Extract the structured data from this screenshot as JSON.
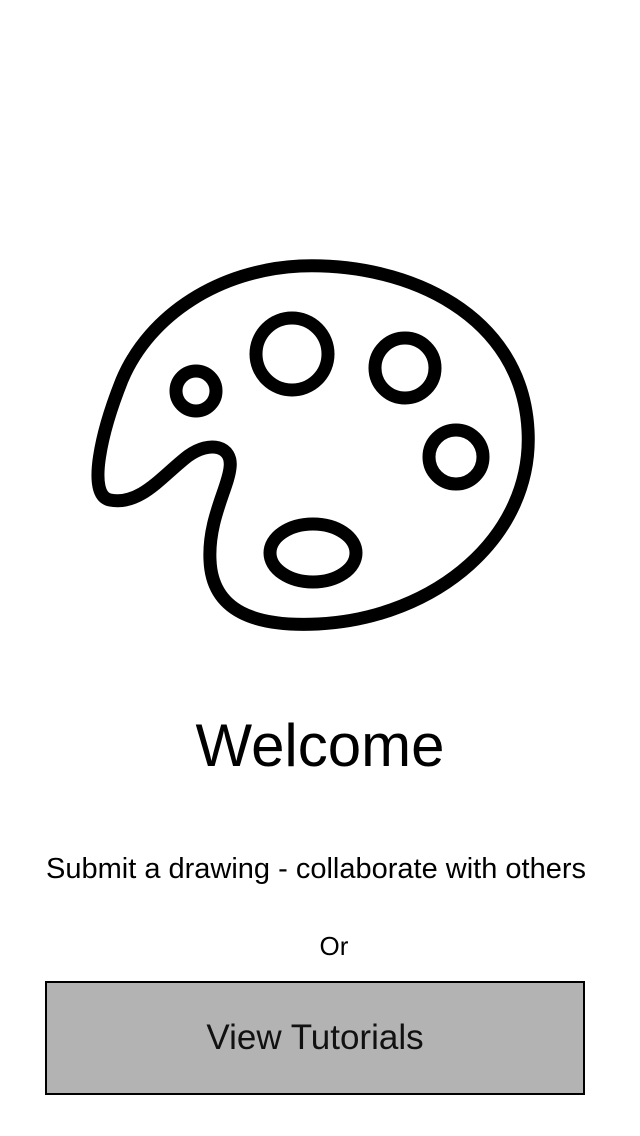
{
  "app": {
    "logo_icon": "paint-palette-icon"
  },
  "welcome": {
    "title": "Welcome",
    "subtitle": "Submit a drawing - collaborate with others",
    "or_label": "Or",
    "tutorials_button_label": "View Tutorials"
  },
  "colors": {
    "background": "#ffffff",
    "button_fill": "#b3b3b3",
    "text": "#000000"
  }
}
